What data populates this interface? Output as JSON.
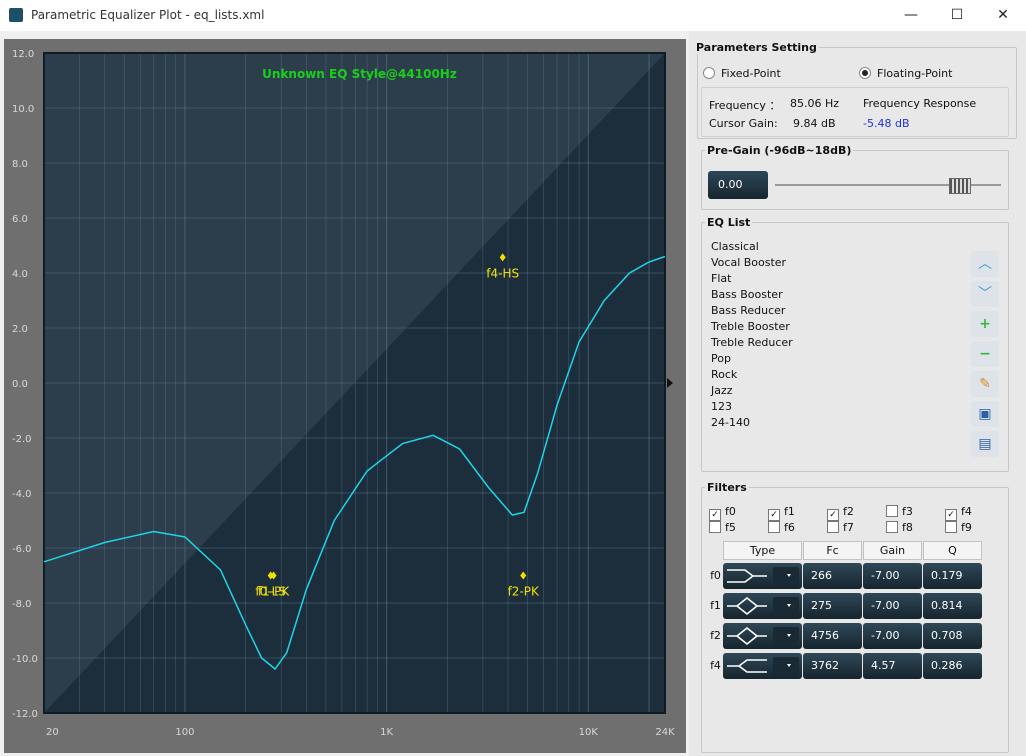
{
  "window": {
    "title": "Parametric Equalizer Plot - eq_lists.xml",
    "minimize": "—",
    "maximize": "☐",
    "close": "✕"
  },
  "plot": {
    "title": "Unknown EQ Style@44100Hz",
    "y_ticks": [
      "12.0",
      "10.0",
      "8.0",
      "6.0",
      "4.0",
      "2.0",
      "0.0",
      "-2.0",
      "-4.0",
      "-6.0",
      "-8.0",
      "-10.0",
      "-12.0"
    ],
    "x_ticks": [
      "20",
      "100",
      "1K",
      "10K",
      "24K"
    ],
    "markers": [
      {
        "label": "f0-LS",
        "freq": 266,
        "gain": -7.0
      },
      {
        "label": "f1-PK",
        "freq": 275,
        "gain": -7.0
      },
      {
        "label": "f2-PK",
        "freq": 4756,
        "gain": -7.0
      },
      {
        "label": "f4-HS",
        "freq": 3762,
        "gain": 4.57
      }
    ],
    "curve_color": "#1fd4e8",
    "title_color": "#18d018",
    "marker_color": "#f0e000"
  },
  "params": {
    "group_title": "Parameters Setting",
    "fixed_label": "Fixed-Point",
    "floating_label": "Floating-Point",
    "selected": "floating",
    "freq_label": "Frequency ：",
    "freq_value": "85.06 Hz",
    "cursor_label": "Cursor Gain:",
    "cursor_value": "9.84 dB",
    "resp_label": "Frequency Response",
    "resp_value": "-5.48 dB"
  },
  "pregain": {
    "title": "Pre-Gain (-96dB~18dB)",
    "value": "0.00"
  },
  "eqlist": {
    "title": "EQ List",
    "items": [
      "Classical",
      "Vocal Booster",
      "Flat",
      "Bass Booster",
      "Bass Reducer",
      "Treble Booster",
      "Treble Reducer",
      "Pop",
      "Rock",
      "Jazz",
      "123",
      "24-140"
    ]
  },
  "filters": {
    "title": "Filters",
    "checks": [
      {
        "label": "f0",
        "checked": true
      },
      {
        "label": "f1",
        "checked": true
      },
      {
        "label": "f2",
        "checked": true
      },
      {
        "label": "f3",
        "checked": false
      },
      {
        "label": "f4",
        "checked": true
      },
      {
        "label": "f5",
        "checked": false
      },
      {
        "label": "f6",
        "checked": false
      },
      {
        "label": "f7",
        "checked": false
      },
      {
        "label": "f8",
        "checked": false
      },
      {
        "label": "f9",
        "checked": false
      }
    ],
    "headers": [
      "Type",
      "Fc",
      "Gain",
      "Q"
    ],
    "rows": [
      {
        "id": "f0",
        "fc": "266",
        "gain": "-7.00",
        "q": "0.179"
      },
      {
        "id": "f1",
        "fc": "275",
        "gain": "-7.00",
        "q": "0.814"
      },
      {
        "id": "f2",
        "fc": "4756",
        "gain": "-7.00",
        "q": "0.708"
      },
      {
        "id": "f4",
        "fc": "3762",
        "gain": "4.57",
        "q": "0.286"
      }
    ]
  }
}
